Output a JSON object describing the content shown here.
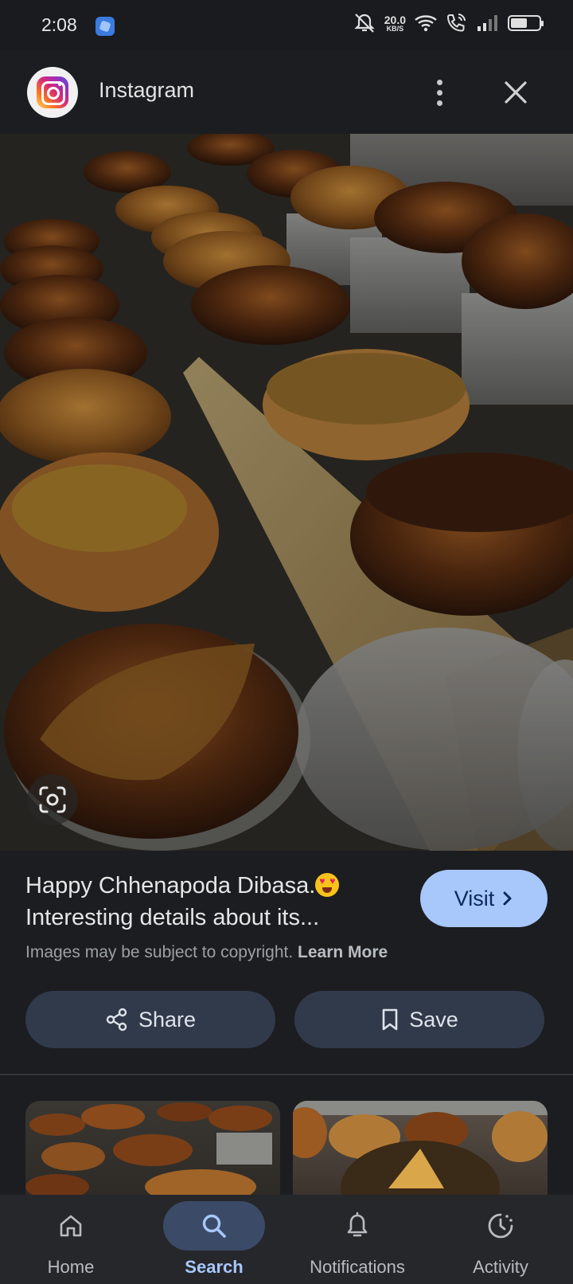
{
  "status_bar": {
    "time": "2:08",
    "net_speed_value": "20.0",
    "net_speed_unit": "KB/S",
    "icons": [
      "app-notification-icon",
      "mute-icon",
      "wifi-icon",
      "wifi-calling-icon",
      "signal-icon",
      "battery-icon"
    ]
  },
  "app_bar": {
    "source_name": "Instagram",
    "more_icon": "more-vert-icon",
    "close_icon": "close-icon"
  },
  "hero": {
    "lens_icon": "lens-icon"
  },
  "info": {
    "title": "Happy Chhenapoda Dibasa.",
    "title_line2": "Interesting details about its...",
    "visit_label": "Visit",
    "copyright_text": "Images may be subject to copyright.",
    "learn_more": "Learn More",
    "share_label": "Share",
    "save_label": "Save"
  },
  "bottom_nav": {
    "items": [
      {
        "label": "Home",
        "icon": "home-icon",
        "active": false
      },
      {
        "label": "Search",
        "icon": "search-icon",
        "active": true
      },
      {
        "label": "Notifications",
        "icon": "bell-icon",
        "active": false
      },
      {
        "label": "Activity",
        "icon": "activity-icon",
        "active": false
      }
    ]
  },
  "colors": {
    "accent": "#a8c7fa",
    "background": "#1c1d20",
    "chip": "#313a4a"
  }
}
